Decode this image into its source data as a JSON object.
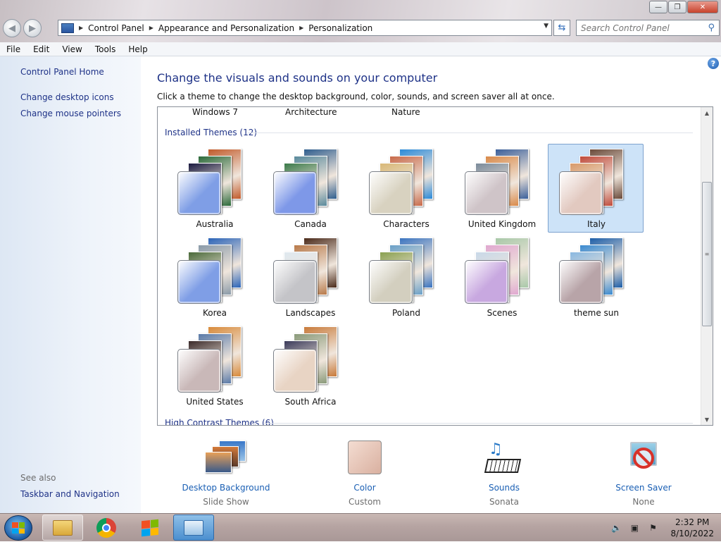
{
  "window": {
    "buttons": {
      "minimize": "—",
      "maximize": "❐",
      "close": "✕"
    }
  },
  "nav": {
    "back": "◀",
    "forward": "▶",
    "breadcrumb": [
      "Control Panel",
      "Appearance and Personalization",
      "Personalization"
    ],
    "search_placeholder": "Search Control Panel"
  },
  "menu": [
    "File",
    "Edit",
    "View",
    "Tools",
    "Help"
  ],
  "sidebar": {
    "home": "Control Panel Home",
    "links": [
      "Change desktop icons",
      "Change mouse pointers"
    ],
    "see_also": "See also",
    "see_also_links": [
      "Taskbar and Navigation"
    ]
  },
  "main": {
    "help": "?",
    "title": "Change the visuals and sounds on your computer",
    "subtitle": "Click a theme to change the desktop background, color, sounds, and screen saver all at once.",
    "top_row_partial": [
      "Windows 7",
      "Architecture",
      "Nature"
    ],
    "installed_title": "Installed Themes (12)",
    "high_contrast_title": "High Contrast Themes (6)",
    "themes": [
      {
        "label": "Australia",
        "selected": false,
        "swatch": "#7f9ee6",
        "photos": [
          "#c15a2a",
          "#2b6a3a",
          "#1a1a40"
        ]
      },
      {
        "label": "Canada",
        "selected": false,
        "swatch": "#7e98e8",
        "photos": [
          "#2f5e8e",
          "#5a8a9c",
          "#3b7a4a"
        ]
      },
      {
        "label": "Characters",
        "selected": false,
        "swatch": "#d8d2c0",
        "photos": [
          "#2b8ad8",
          "#c86a4a",
          "#d8b878"
        ]
      },
      {
        "label": "United Kingdom",
        "selected": true,
        "swatch": "#cfc4c8",
        "photos": [
          "#3a5f9a",
          "#d98a4a",
          "#7a8a9a"
        ]
      },
      {
        "label": "Italy",
        "selected": true,
        "swatch": "#e2c9c0",
        "photos": [
          "#6a4a3a",
          "#c04a3a",
          "#d89a6a"
        ]
      },
      {
        "label": "Korea",
        "selected": false,
        "swatch": "#7f9ee6",
        "photos": [
          "#2b64b8",
          "#8a9aa8",
          "#4a6a3a"
        ]
      },
      {
        "label": "Landscapes",
        "selected": false,
        "swatch": "#c4c4c8",
        "photos": [
          "#4a2a1a",
          "#b87a4a",
          "#dfe8ef"
        ]
      },
      {
        "label": "Poland",
        "selected": false,
        "swatch": "#d3cfbf",
        "photos": [
          "#3a74c0",
          "#6aa0c8",
          "#8aa050"
        ]
      },
      {
        "label": "Scenes",
        "selected": false,
        "swatch": "#c8a8e0",
        "photos": [
          "#a8c8a8",
          "#e0a8d0",
          "#c8d8e8"
        ]
      },
      {
        "label": "theme sun",
        "selected": false,
        "swatch": "#b8a4a8",
        "photos": [
          "#1c5ea8",
          "#3a8ad0",
          "#8ab8e0"
        ]
      },
      {
        "label": "United States",
        "selected": false,
        "swatch": "#c9b8b8",
        "photos": [
          "#d88a3a",
          "#5a7aa8",
          "#3a2a2a"
        ]
      },
      {
        "label": "South Africa",
        "selected": false,
        "swatch": "#e8d4c4",
        "photos": [
          "#c87a3a",
          "#8a9a7a",
          "#3a3a5a"
        ]
      }
    ]
  },
  "bottom": {
    "items": [
      {
        "name": "desktop-background",
        "label": "Desktop Background",
        "value": "Slide Show",
        "icon": "photo-stack-icon"
      },
      {
        "name": "color",
        "label": "Color",
        "value": "Custom",
        "icon": "color-swatch-icon",
        "color": "#e2c2b4"
      },
      {
        "name": "sounds",
        "label": "Sounds",
        "value": "Sonata",
        "icon": "music-keyboard-icon"
      },
      {
        "name": "screen-saver",
        "label": "Screen Saver",
        "value": "None",
        "icon": "no-screensaver-icon"
      }
    ]
  },
  "taskbar": {
    "clock_time": "2:32 PM",
    "clock_date": "8/10/2022",
    "apps": [
      "file-explorer-icon",
      "chrome-icon",
      "windows-media-icon",
      "control-panel-icon"
    ]
  },
  "colors": {
    "link": "#1e3287",
    "accent_link": "#1a5fb4",
    "selection": "#cde3f8"
  }
}
